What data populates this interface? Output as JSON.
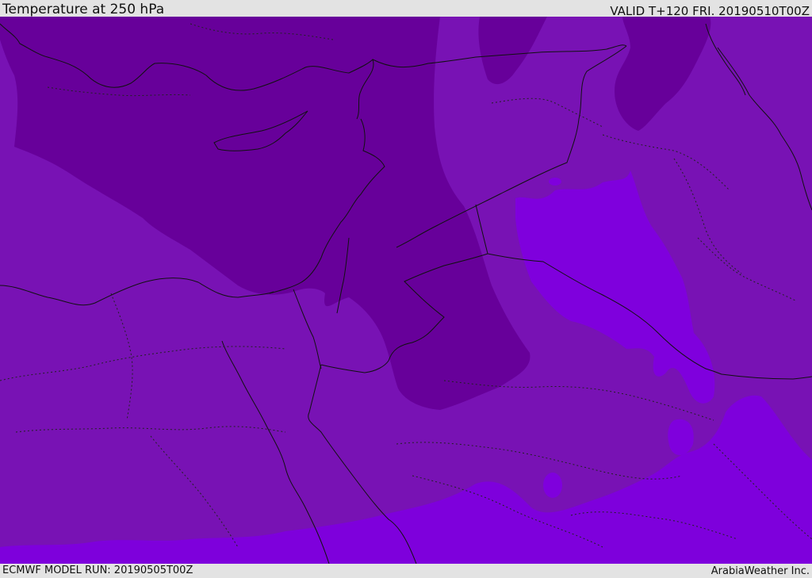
{
  "header": {
    "title": "Temperature at 250 hPa",
    "valid_time": "VALID T+120 FRI. 20190510T00Z"
  },
  "footer": {
    "model_run": "ECMWF MODEL RUN: 20190505T00Z",
    "credit": "ArabiaWeather Inc."
  },
  "colors": {
    "background": "#e3e3e3",
    "band_cold": "#67009a",
    "band_mid": "#7812b4",
    "band_warm_light": "#7f00dd",
    "band_warm": "#7e00dc",
    "coast_line": "#111111"
  }
}
